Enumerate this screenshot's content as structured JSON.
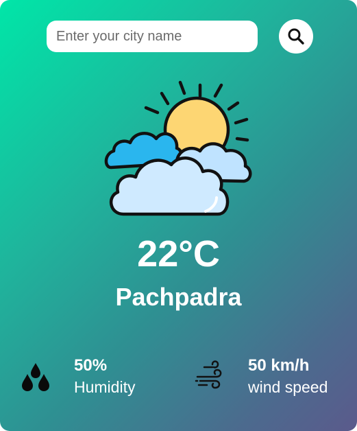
{
  "search": {
    "placeholder": "Enter your city name",
    "icon": "search-icon"
  },
  "weather": {
    "icon": "partly-cloudy-icon",
    "temperature": "22°C",
    "city": "Pachpadra"
  },
  "humidity": {
    "icon": "humidity-drops-icon",
    "value": "50%",
    "label": "Humidity"
  },
  "wind": {
    "icon": "wind-icon",
    "value": "50 km/h",
    "label": "wind speed"
  },
  "colors": {
    "gradient_start": "#00e6a8",
    "gradient_end": "#5b5a8c",
    "sun": "#fdd673",
    "cloud": "#cfeaff",
    "cloud_back": "#2ab6ee"
  }
}
